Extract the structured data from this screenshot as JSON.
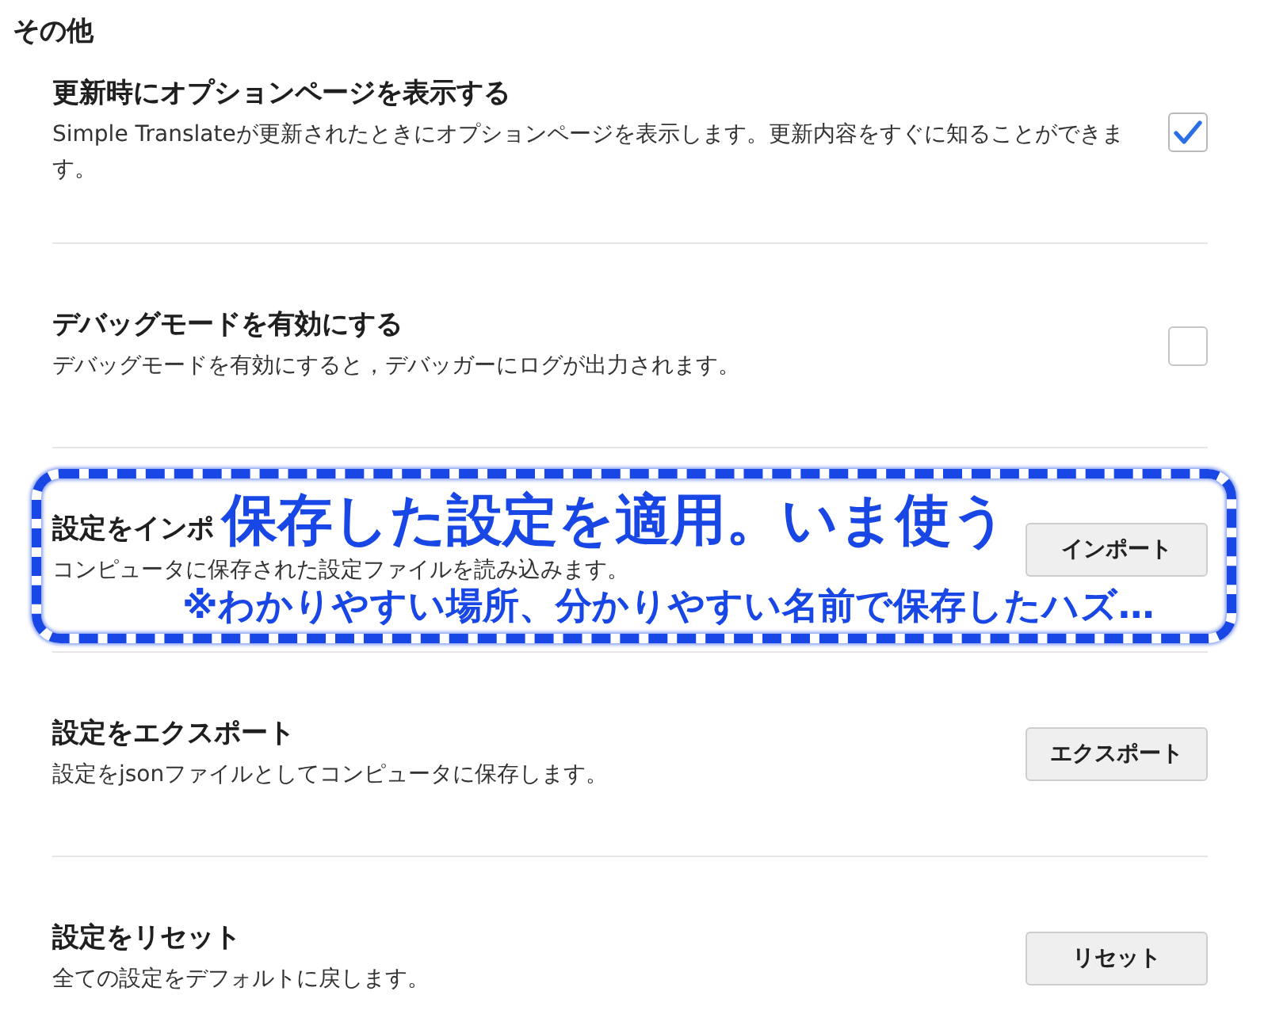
{
  "section": {
    "title": "その他"
  },
  "settings": [
    {
      "kind": "checkbox",
      "title": "更新時にオプションページを表示する",
      "description": "Simple Translateが更新されたときにオプションページを表示します。更新内容をすぐに知ることができます。",
      "checked": true
    },
    {
      "kind": "checkbox",
      "title": "デバッグモードを有効にする",
      "description": "デバッグモードを有効にすると，デバッガーにログが出力されます。",
      "checked": false
    },
    {
      "kind": "button",
      "title": "設定をインポ",
      "description": "コンピュータに保存された設定ファイルを読み込みます。",
      "button": "インポート",
      "callout": {
        "title": "保存した設定を適用。いま使う",
        "note": "※わかりやすい場所、分かりやすい名前で保存したハズ…"
      }
    },
    {
      "kind": "button",
      "title": "設定をエクスポート",
      "description": "設定をjsonファイルとしてコンピュータに保存します。",
      "button": "エクスポート"
    },
    {
      "kind": "button",
      "title": "設定をリセット",
      "description": "全ての設定をデフォルトに戻します。",
      "button": "リセット"
    }
  ]
}
